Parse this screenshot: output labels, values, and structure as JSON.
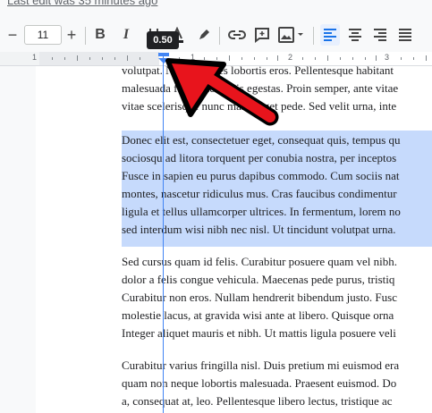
{
  "header": {
    "last_edit": "Last edit was 35 minutes ago"
  },
  "toolbar": {
    "font_size": "11",
    "minus": "−",
    "plus": "+",
    "bold": "B",
    "italic": "I",
    "tooltip": "0.50"
  },
  "ruler": {
    "numbers": [
      "1",
      "1",
      "2",
      "3"
    ]
  },
  "document": {
    "para1": [
      "volutpat. Nunc ultrices lobortis eros. Pellentesque habitant",
      "malesuada fames ac turpis egestas. Proin semper, ante vitae",
      "vitae scelerisque nunc massa eget pede. Sed velit urna, inte"
    ],
    "para2": [
      "Donec elit est, consectetuer eget, consequat quis, tempus qu",
      "sociosqu ad litora torquent per conubia nostra, per inceptos",
      "Fusce in sapien eu purus dapibus commodo. Cum sociis nat",
      "montes, nascetur ridiculus mus. Cras faucibus condimentur",
      "ligula et tellus ullamcorper ultrices. In fermentum, lorem no",
      "sed interdum wisi nibh nec nisl. Ut tincidunt volutpat urna."
    ],
    "para3": [
      "Sed cursus quam id felis. Curabitur posuere quam vel nibh.",
      "dolor a felis congue vehicula. Maecenas pede purus, tristiq",
      "Curabitur non eros. Nullam hendrerit bibendum justo. Fusc",
      "molestie lacus, at gravida wisi ante at libero. Quisque orna",
      "Integer aliquet mauris et nibh. Ut mattis ligula posuere veli"
    ],
    "para4": [
      "Curabitur varius fringilla nisl. Duis pretium mi euismod era",
      "quam non neque lobortis malesuada. Praesent euismod. Do",
      "a, consequat at, leo. Pellentesque libero lectus, tristique ac"
    ]
  },
  "colors": {
    "selection": "#c6dafc",
    "guide": "#4285f4",
    "arrow": "#e8141c",
    "align_active": "#1a73e8"
  }
}
